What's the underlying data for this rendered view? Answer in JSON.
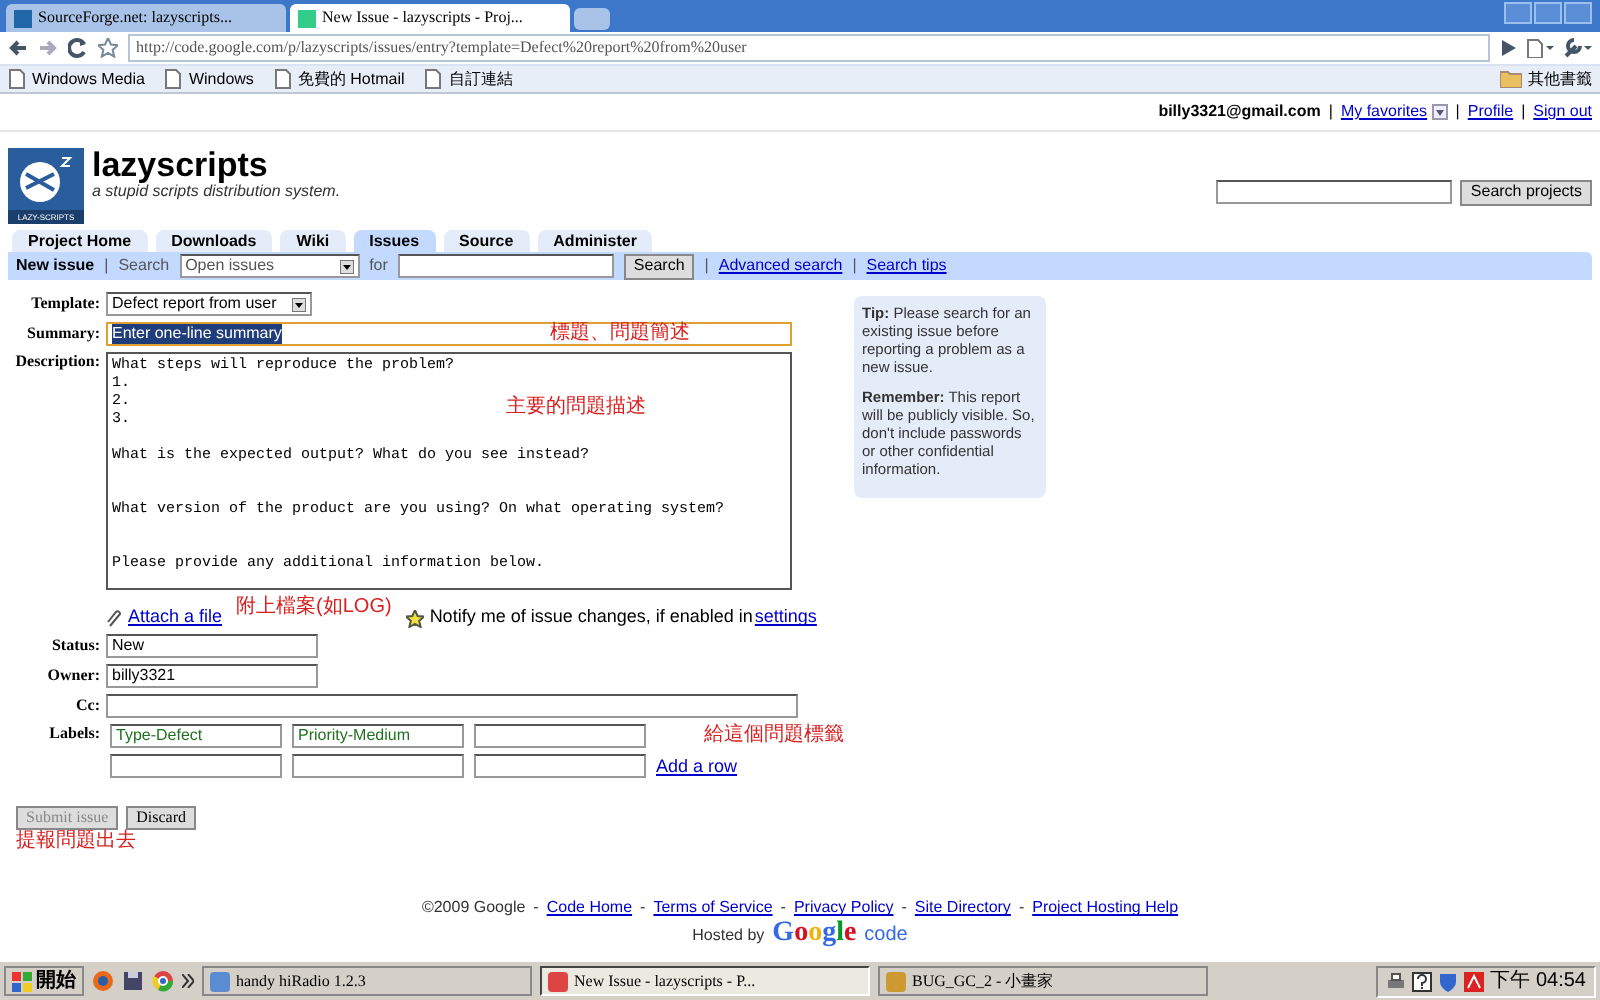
{
  "browser": {
    "tabs": [
      {
        "title": "SourceForge.net: lazyscripts...",
        "selected": false
      },
      {
        "title": "New Issue - lazyscripts - Proj...",
        "selected": true
      }
    ],
    "url": "http://code.google.com/p/lazyscripts/issues/entry?template=Defect%20report%20from%20user",
    "bookmarks": [
      "Windows Media",
      "Windows",
      "免費的 Hotmail",
      "自訂連結"
    ],
    "other_bookmarks": "其他書籤"
  },
  "account": {
    "email": "billy3321@gmail.com",
    "separator": "|",
    "links": [
      "My favorites",
      "Profile",
      "Sign out"
    ]
  },
  "project": {
    "name": "lazyscripts",
    "summary": "a stupid scripts distribution system.",
    "logo_text": "LAZY-SCRIPTS"
  },
  "project_search": {
    "button": "Search projects"
  },
  "nav_tabs": [
    {
      "label": "Project Home",
      "selected": false
    },
    {
      "label": "Downloads",
      "selected": false
    },
    {
      "label": "Wiki",
      "selected": false
    },
    {
      "label": "Issues",
      "selected": true
    },
    {
      "label": "Source",
      "selected": false
    },
    {
      "label": "Administer",
      "selected": false
    }
  ],
  "subnav": {
    "new_issue": "New issue",
    "separator": "|",
    "search_label": "Search",
    "scope": "Open issues",
    "for_label": "for",
    "button": "Search",
    "links": [
      "Advanced search",
      "Search tips"
    ]
  },
  "form": {
    "template": {
      "label": "Template:",
      "value": "Defect report from user"
    },
    "summary": {
      "label": "Summary:",
      "value": "Enter one-line summary",
      "note": "標題、問題簡述"
    },
    "description": {
      "label": "Description:",
      "value": "What steps will reproduce the problem?\n1.\n2.\n3.\n\nWhat is the expected output? What do you see instead?\n\n\nWhat version of the product are you using? On what operating system?\n\n\nPlease provide any additional information below.",
      "note": "主要的問題描述"
    },
    "attach": {
      "link": "Attach a file",
      "note": "附上檔案(如LOG)"
    },
    "notify": {
      "text": "Notify me of issue changes, if enabled in",
      "link": "settings"
    },
    "status": {
      "label": "Status:",
      "value": "New"
    },
    "owner": {
      "label": "Owner:",
      "value": "billy3321"
    },
    "cc": {
      "label": "Cc:"
    },
    "labels": {
      "label": "Labels:",
      "rows": [
        [
          "Type-Defect",
          "Priority-Medium",
          ""
        ],
        [
          "",
          "",
          ""
        ]
      ],
      "note": "給這個問題標籤",
      "add_row": "Add a row"
    },
    "buttons": [
      {
        "label": "Submit issue",
        "disabled": true
      },
      {
        "label": "Discard",
        "disabled": false
      }
    ],
    "submit_note": "提報問題出去"
  },
  "tip": [
    "**Tip:** Please search for an existing issue before reporting a problem as a new issue.",
    "**Remember:** This report will be publicly visible. So, don't include passwords or other confidential information."
  ],
  "footer": {
    "copyright": "©2009 Google",
    "separator": "-",
    "links": [
      "Code Home",
      "Terms of Service",
      "Privacy Policy",
      "Site Directory",
      "Project Hosting Help"
    ],
    "hosted_by": "Hosted by",
    "logo": "Google",
    "logo_suffix": "code"
  },
  "taskbar": {
    "start": "開始",
    "tasks": [
      {
        "title": "handy hiRadio 1.2.3",
        "selected": false
      },
      {
        "title": "New Issue - lazyscripts - P...",
        "selected": true
      },
      {
        "title": "BUG_GC_2 - 小畫家",
        "selected": false
      }
    ],
    "clock": "下午 04:54"
  }
}
